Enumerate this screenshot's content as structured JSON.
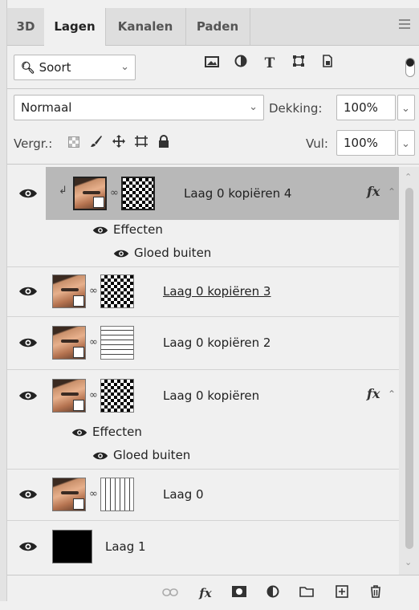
{
  "tabs": [
    {
      "label": "3D"
    },
    {
      "label": "Lagen",
      "active": true
    },
    {
      "label": "Kanalen"
    },
    {
      "label": "Paden"
    }
  ],
  "filter": {
    "kind_label": "Soort"
  },
  "blend": {
    "mode": "Normaal",
    "opacity_label": "Dekking:",
    "opacity_value": "100%"
  },
  "lock": {
    "label": "Vergr.:",
    "fill_label": "Vul:",
    "fill_value": "100%"
  },
  "layers": [
    {
      "name": "Laag 0 kopiëren 4",
      "selected": true,
      "fx": "fx",
      "effects_label": "Effecten",
      "effect": "Gloed buiten"
    },
    {
      "name": "Laag 0 kopiëren 3"
    },
    {
      "name": "Laag 0 kopiëren 2"
    },
    {
      "name": "Laag 0 kopiëren",
      "fx": "fx",
      "effects_label": "Effecten",
      "effect": "Gloed buiten"
    },
    {
      "name": "Laag 0"
    },
    {
      "name": "Laag 1"
    }
  ],
  "icons": {
    "menu": "hamburger-menu-icon",
    "search": "search-icon",
    "eye": "eye-icon",
    "link": "chain-link-icon"
  },
  "colors": {
    "selected_row": "#b8b8b8",
    "panel_bg": "#f0f0f0"
  }
}
